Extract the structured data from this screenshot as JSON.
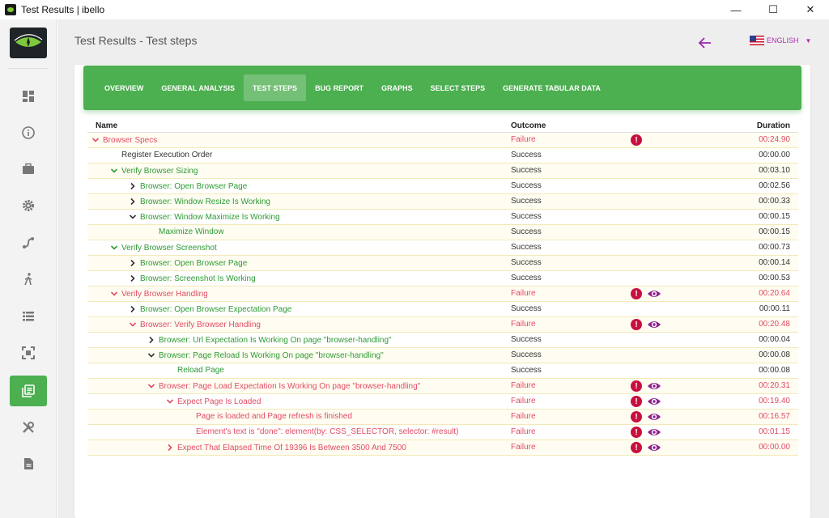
{
  "window": {
    "title": "Test Results | ibello",
    "minimize": "—",
    "maximize": "☐",
    "close": "✕"
  },
  "header": {
    "page_title": "Test Results - Test steps",
    "language": "ENGLISH"
  },
  "tabs": [
    {
      "label": "OVERVIEW",
      "active": false
    },
    {
      "label": "GENERAL ANALYSIS",
      "active": false
    },
    {
      "label": "TEST STEPS",
      "active": true
    },
    {
      "label": "BUG REPORT",
      "active": false
    },
    {
      "label": "GRAPHS",
      "active": false
    },
    {
      "label": "SELECT STEPS",
      "active": false
    },
    {
      "label": "GENERATE TABULAR DATA",
      "active": false
    }
  ],
  "table": {
    "headers": {
      "name": "Name",
      "outcome": "Outcome",
      "duration": "Duration"
    },
    "rows": [
      {
        "name": "Browser Specs",
        "level": 0,
        "expander": "down",
        "outcome": "Failure",
        "status": "fail",
        "duration": "00:24.90",
        "error": true,
        "view": false,
        "highlight": true
      },
      {
        "name": "Register Execution Order",
        "level": 1,
        "expander": "none",
        "outcome": "Success",
        "status": "plain",
        "duration": "00:00.00",
        "error": false,
        "view": false,
        "highlight": false
      },
      {
        "name": "Verify Browser Sizing",
        "level": 1,
        "expander": "down",
        "outcome": "Success",
        "status": "ok",
        "duration": "00:03.10",
        "error": false,
        "view": false,
        "highlight": true
      },
      {
        "name": "Browser: Open Browser Page",
        "level": 2,
        "expander": "right",
        "outcome": "Success",
        "status": "ok",
        "duration": "00:02.56",
        "error": false,
        "view": false,
        "highlight": false
      },
      {
        "name": "Browser: Window Resize Is Working",
        "level": 2,
        "expander": "right",
        "outcome": "Success",
        "status": "ok",
        "duration": "00:00.33",
        "error": false,
        "view": false,
        "highlight": true
      },
      {
        "name": "Browser: Window Maximize Is Working",
        "level": 2,
        "expander": "down",
        "outcome": "Success",
        "status": "ok",
        "duration": "00:00.15",
        "error": false,
        "view": false,
        "highlight": false
      },
      {
        "name": "Maximize Window",
        "level": 3,
        "expander": "none",
        "outcome": "Success",
        "status": "ok",
        "duration": "00:00.15",
        "error": false,
        "view": false,
        "highlight": true
      },
      {
        "name": "Verify Browser Screenshot",
        "level": 1,
        "expander": "down",
        "outcome": "Success",
        "status": "ok",
        "duration": "00:00.73",
        "error": false,
        "view": false,
        "highlight": false
      },
      {
        "name": "Browser: Open Browser Page",
        "level": 2,
        "expander": "right",
        "outcome": "Success",
        "status": "ok",
        "duration": "00:00.14",
        "error": false,
        "view": false,
        "highlight": true
      },
      {
        "name": "Browser: Screenshot Is Working",
        "level": 2,
        "expander": "right",
        "outcome": "Success",
        "status": "ok",
        "duration": "00:00.53",
        "error": false,
        "view": false,
        "highlight": false
      },
      {
        "name": "Verify Browser Handling",
        "level": 1,
        "expander": "down",
        "outcome": "Failure",
        "status": "fail",
        "duration": "00:20.64",
        "error": true,
        "view": true,
        "highlight": true
      },
      {
        "name": "Browser: Open Browser Expectation Page",
        "level": 2,
        "expander": "right",
        "outcome": "Success",
        "status": "ok",
        "duration": "00:00.11",
        "error": false,
        "view": false,
        "highlight": false
      },
      {
        "name": "Browser: Verify Browser Handling",
        "level": 2,
        "expander": "down",
        "outcome": "Failure",
        "status": "fail",
        "duration": "00:20.48",
        "error": true,
        "view": true,
        "highlight": true
      },
      {
        "name": "Browser: Url Expectation Is Working On page \"browser-handling\"",
        "level": 3,
        "expander": "right",
        "outcome": "Success",
        "status": "ok",
        "duration": "00:00.04",
        "error": false,
        "view": false,
        "highlight": false
      },
      {
        "name": "Browser: Page Reload Is Working On page \"browser-handling\"",
        "level": 3,
        "expander": "down",
        "outcome": "Success",
        "status": "ok",
        "duration": "00:00.08",
        "error": false,
        "view": false,
        "highlight": true
      },
      {
        "name": "Reload Page",
        "level": 4,
        "expander": "none",
        "outcome": "Success",
        "status": "ok",
        "duration": "00:00.08",
        "error": false,
        "view": false,
        "highlight": false
      },
      {
        "name": "Browser: Page Load Expectation Is Working On page \"browser-handling\"",
        "level": 3,
        "expander": "down",
        "outcome": "Failure",
        "status": "fail",
        "duration": "00:20.31",
        "error": true,
        "view": true,
        "highlight": true
      },
      {
        "name": "Expect Page Is Loaded",
        "level": 4,
        "expander": "down",
        "outcome": "Failure",
        "status": "fail",
        "duration": "00:19.40",
        "error": true,
        "view": true,
        "highlight": false
      },
      {
        "name": "Page is loaded and Page refresh is finished",
        "level": 5,
        "expander": "none",
        "outcome": "Failure",
        "status": "fail",
        "duration": "00:16.57",
        "error": true,
        "view": true,
        "highlight": true
      },
      {
        "name": "Element's text is \"done\": element(by: CSS_SELECTOR, selector: #result)",
        "level": 5,
        "expander": "none",
        "outcome": "Failure",
        "status": "fail",
        "duration": "00:01.15",
        "error": true,
        "view": true,
        "highlight": false
      },
      {
        "name": "Expect That Elapsed Time Of 19396 Is Between 3500 And 7500",
        "level": 4,
        "expander": "right",
        "outcome": "Failure",
        "status": "fail",
        "duration": "00:00.00",
        "error": true,
        "view": true,
        "highlight": true
      }
    ]
  },
  "colors": {
    "accent": "#4caf50",
    "failure": "#e04b63",
    "success": "#2e9a34",
    "error_badge": "#c8103e",
    "eye": "#8e1f8e",
    "lang": "#b12db1"
  }
}
